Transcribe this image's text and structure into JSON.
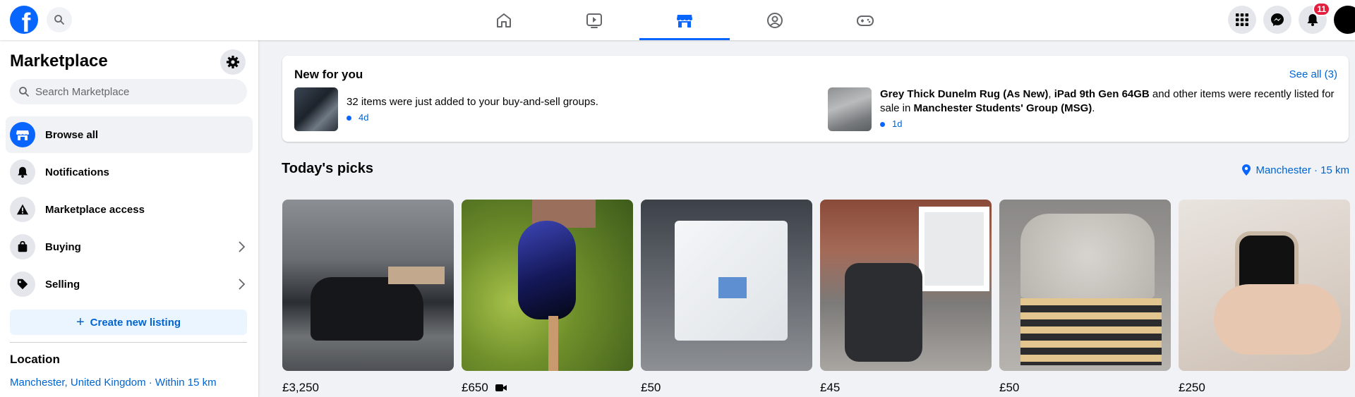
{
  "topbar": {
    "logo_letter": "f",
    "nav": [
      "home-icon",
      "video-icon",
      "marketplace-icon",
      "groups-icon",
      "gaming-icon"
    ],
    "active_nav": "marketplace-icon",
    "notification_count": "11"
  },
  "sidebar": {
    "title": "Marketplace",
    "search_placeholder": "Search Marketplace",
    "items": [
      {
        "label": "Browse all",
        "icon": "storefront-icon"
      },
      {
        "label": "Notifications",
        "icon": "bell-icon"
      },
      {
        "label": "Marketplace access",
        "icon": "warning-icon"
      },
      {
        "label": "Buying",
        "icon": "bag-icon"
      },
      {
        "label": "Selling",
        "icon": "tag-icon"
      }
    ],
    "create_label": "Create new listing",
    "location_title": "Location",
    "location_value": "Manchester, United Kingdom · Within 15 km"
  },
  "new_for_you": {
    "title": "New for you",
    "see_all": "See all (3)",
    "n1": {
      "text": "32 items were just added to your buy-and-sell groups.",
      "time": "4d"
    },
    "n2": {
      "bold1": "Grey Thick Dunelm Rug (As New)",
      "sep": ", ",
      "bold2": "iPad 9th Gen 64GB",
      "mid": " and other items were recently listed for sale in ",
      "bold3": "Manchester Students' Group (MSG)",
      "end": ".",
      "time": "1d"
    }
  },
  "todays_picks": {
    "title": "Today's picks",
    "location": "Manchester · 15 km",
    "items": [
      {
        "price": "£3,250"
      },
      {
        "price": "£650"
      },
      {
        "price": "£50"
      },
      {
        "price": "£45"
      },
      {
        "price": "£50"
      },
      {
        "price": "£250"
      }
    ]
  },
  "colors": {
    "accent": "#0866ff",
    "link": "#0064d1",
    "badge": "#e41e3f"
  }
}
